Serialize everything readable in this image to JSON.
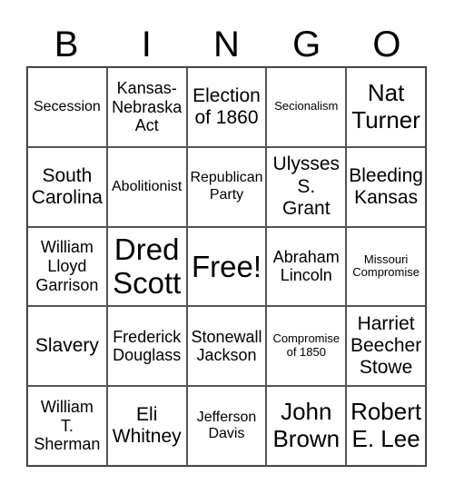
{
  "header": [
    "B",
    "I",
    "N",
    "G",
    "O"
  ],
  "cells": [
    {
      "text": "Secession",
      "size": "fs-s"
    },
    {
      "text": "Kansas-\nNebraska\nAct",
      "size": "fs-m"
    },
    {
      "text": "Election\nof 1860",
      "size": "fs-l"
    },
    {
      "text": "Secionalism",
      "size": "fs-xs"
    },
    {
      "text": "Nat\nTurner",
      "size": "fs-xl"
    },
    {
      "text": "South\nCarolina",
      "size": "fs-l"
    },
    {
      "text": "Abolitionist",
      "size": "fs-s"
    },
    {
      "text": "Republican\nParty",
      "size": "fs-s"
    },
    {
      "text": "Ulysses\nS.\nGrant",
      "size": "fs-l"
    },
    {
      "text": "Bleeding\nKansas",
      "size": "fs-l"
    },
    {
      "text": "William\nLloyd\nGarrison",
      "size": "fs-m"
    },
    {
      "text": "Dred\nScott",
      "size": "fs-xxl"
    },
    {
      "text": "Free!",
      "size": "fs-xxl"
    },
    {
      "text": "Abraham\nLincoln",
      "size": "fs-m"
    },
    {
      "text": "Missouri\nCompromise",
      "size": "fs-xs"
    },
    {
      "text": "Slavery",
      "size": "fs-l"
    },
    {
      "text": "Frederick\nDouglass",
      "size": "fs-m"
    },
    {
      "text": "Stonewall\nJackson",
      "size": "fs-m"
    },
    {
      "text": "Compromise\nof 1850",
      "size": "fs-xs"
    },
    {
      "text": "Harriet\nBeecher\nStowe",
      "size": "fs-l"
    },
    {
      "text": "William\nT.\nSherman",
      "size": "fs-m"
    },
    {
      "text": "Eli\nWhitney",
      "size": "fs-l"
    },
    {
      "text": "Jefferson\nDavis",
      "size": "fs-s"
    },
    {
      "text": "John\nBrown",
      "size": "fs-xl"
    },
    {
      "text": "Robert\nE. Lee",
      "size": "fs-xl"
    }
  ]
}
